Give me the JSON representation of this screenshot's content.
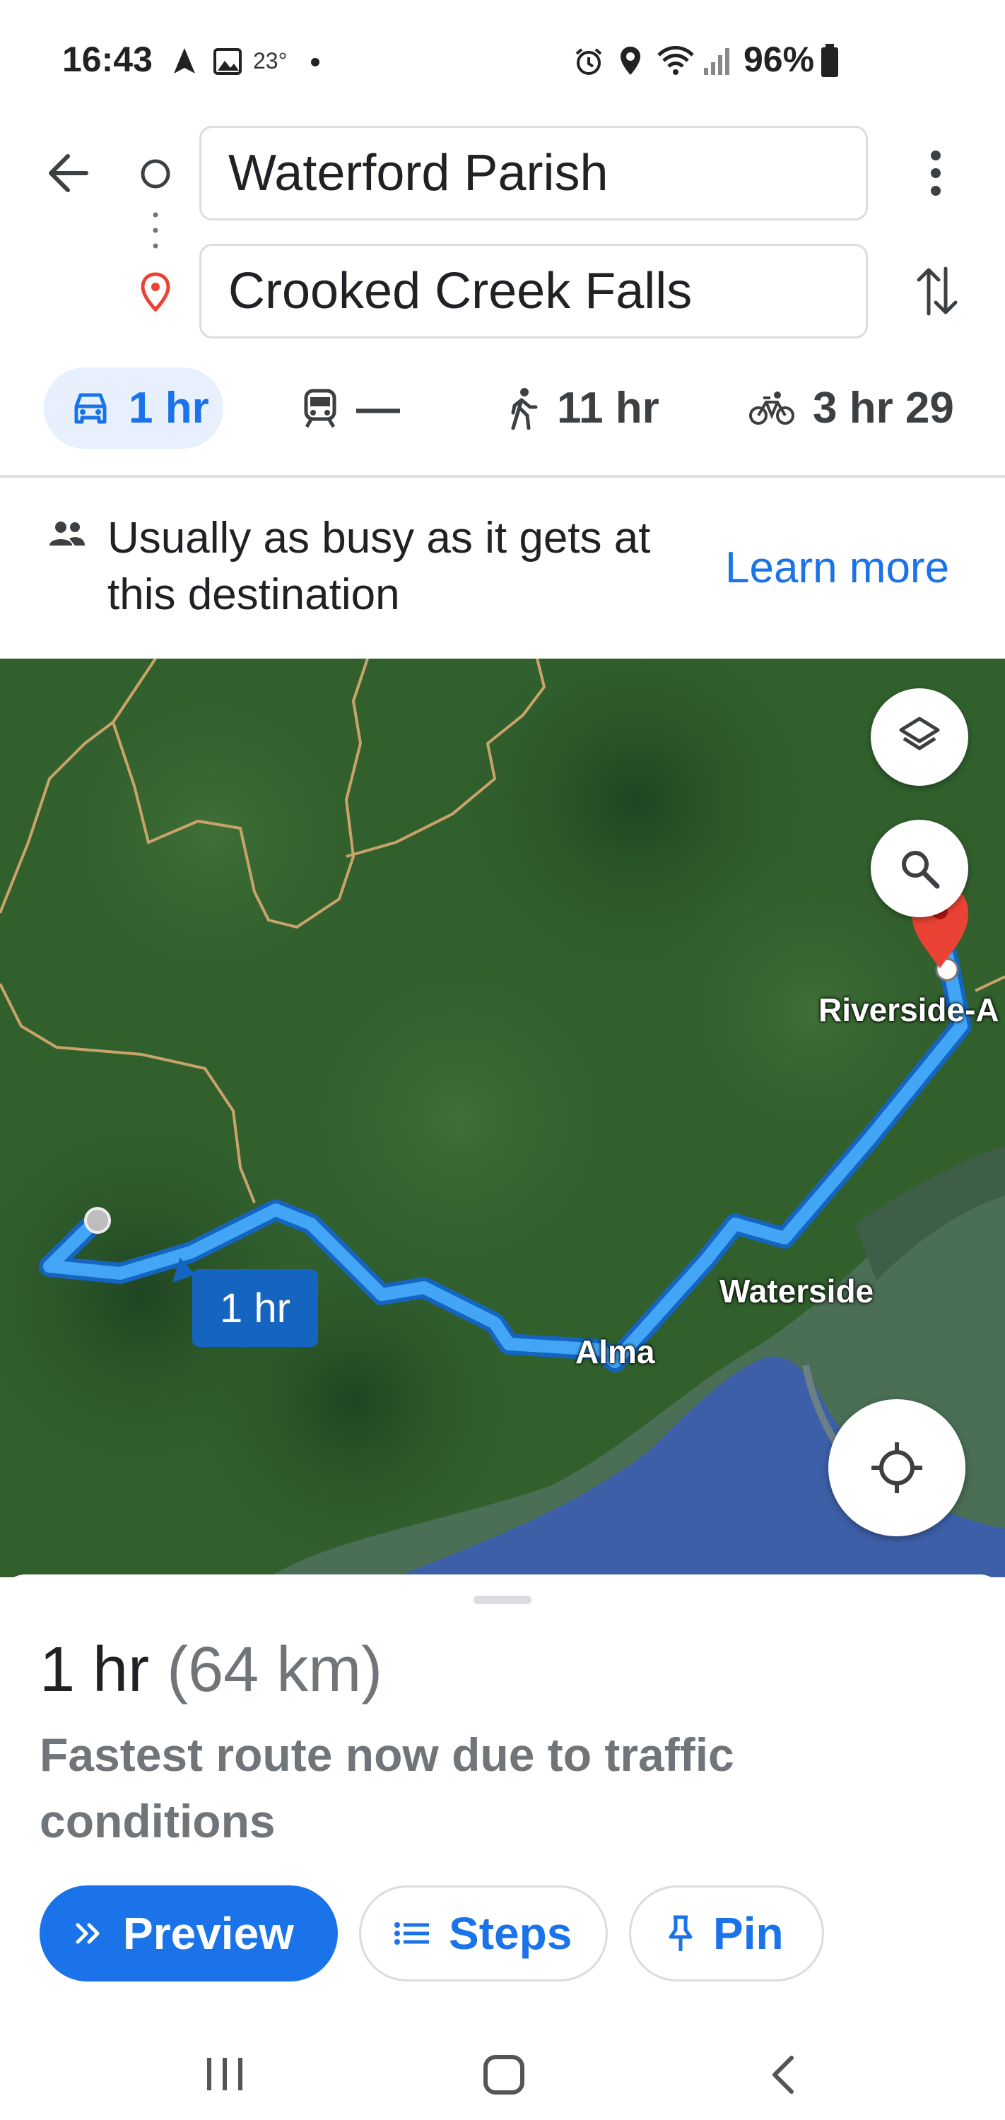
{
  "status_bar": {
    "time": "16:43",
    "temperature": "23°",
    "battery": "96%"
  },
  "directions": {
    "origin": "Waterford Parish",
    "destination": "Crooked Creek Falls"
  },
  "modes": [
    {
      "name": "drive",
      "label": "1 hr",
      "selected": true
    },
    {
      "name": "transit",
      "label": "—",
      "selected": false
    },
    {
      "name": "walk",
      "label": "11 hr",
      "selected": false
    },
    {
      "name": "bike",
      "label": "3 hr 29",
      "selected": false
    }
  ],
  "busy_banner": {
    "text": "Usually as busy as it gets at this destination",
    "link": "Learn more"
  },
  "map": {
    "route_label": "1 hr",
    "places": [
      "Riverside-A",
      "Waterside",
      "Alma"
    ],
    "route_color": "#2196f3"
  },
  "sheet": {
    "duration": "1 hr",
    "distance": "(64 km)",
    "reason": "Fastest route now due to traffic conditions",
    "buttons": {
      "preview": "Preview",
      "steps": "Steps",
      "pin": "Pin"
    }
  },
  "colors": {
    "accent": "#1a73e8",
    "selected_tab_bg": "#e8f0fe",
    "destination_pin": "#ea4335"
  }
}
